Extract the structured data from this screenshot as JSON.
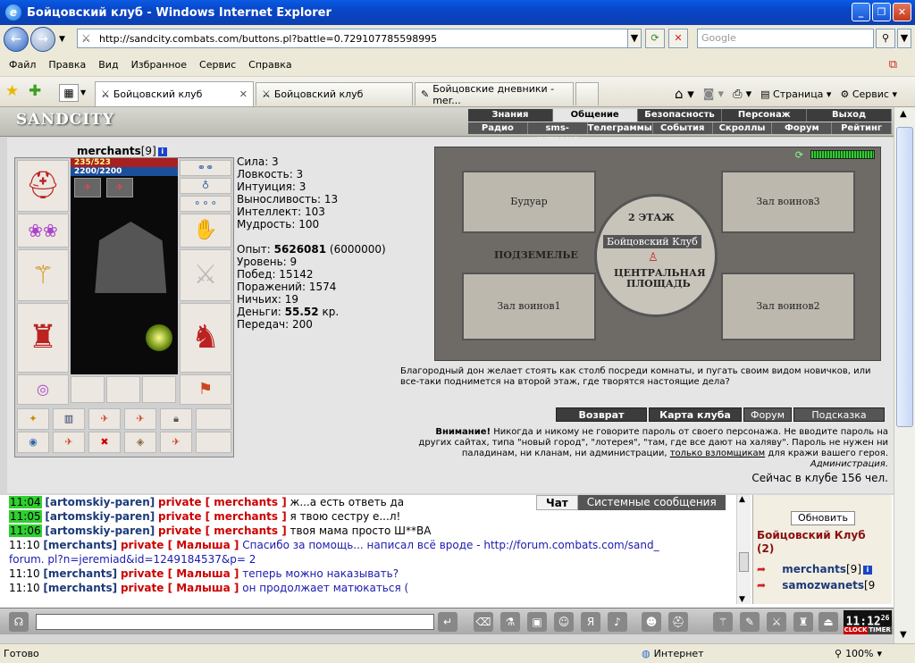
{
  "window": {
    "title": "Бойцовский клуб - Windows Internet Explorer"
  },
  "address": {
    "url": "http://sandcity.combats.com/buttons.pl?battle=0.729107785598995",
    "search_placeholder": "Google"
  },
  "menubar": [
    "Файл",
    "Правка",
    "Вид",
    "Избранное",
    "Сервис",
    "Справка"
  ],
  "tabs": [
    {
      "label": "Бойцовский клуб"
    },
    {
      "label": "Бойцовский клуб"
    },
    {
      "label": "Бойцовские дневники - mer..."
    }
  ],
  "toolbar": {
    "page": "Страница",
    "service": "Сервис"
  },
  "game": {
    "logo": "SANDCITY",
    "main_menu": [
      "Знания",
      "Общение",
      "Безопасность",
      "Персонаж",
      "Выход"
    ],
    "sub_menu": [
      "Радио",
      "sms-история",
      "Телеграммы",
      "События",
      "Скроллы",
      "Форум",
      "Рейтинг"
    ],
    "character": {
      "name": "merchants",
      "level": "[9]",
      "hp": "235/523",
      "mp": "2200/2200"
    },
    "stats": [
      "Сила: 3",
      "Ловкость: 3",
      "Интуиция: 3",
      "Выносливость: 13",
      "Интеллект: 103",
      "Мудрость: 100"
    ],
    "progress": {
      "exp_label": "Опыт:",
      "exp_value": "5626081",
      "exp_next": "(6000000)",
      "level": "Уровень: 9",
      "wins": "Побед: 15142",
      "losses": "Поражений: 1574",
      "draws": "Ничьих: 19",
      "money_label": "Деньги:",
      "money_value": "55.52",
      "money_unit": "кр.",
      "transfers": "Передач: 200"
    },
    "map": {
      "boudoir": "Будуар",
      "hall3": "Зал воинов3",
      "floor2": "2 ЭТАЖ",
      "club": "Бойцовский Клуб",
      "underground": "ПОДЗЕМЕЛЬЕ",
      "central1": "ЦЕНТРАЛЬНАЯ",
      "central2": "ПЛОЩАДЬ",
      "hall1": "Зал воинов1",
      "hall2": "Зал воинов2"
    },
    "description": "Благородный дон желает стоять как столб посреди комнаты, и пугать своим видом новичков, или все-таки поднимется на второй этаж, где творятся настоящие дела?",
    "buttons": {
      "back": "Возврат",
      "map": "Карта клуба",
      "forum": "Форум",
      "hint": "Подсказка"
    },
    "warning": {
      "label": "Внимание!",
      "text1": " Никогда и никому не говорите пароль от своего персонажа. Не вводите пароль на других сайтах, типа \"новый город\", \"лотерея\", \"там, где все дают на халяву\". Пароль не нужен ни паладинам, ни кланам, ни администрации, ",
      "link": "только взломщикам",
      "text2": " для кражи вашего героя.",
      "sign": "Администрация."
    },
    "online": "Сейчас в клубе 156 чел."
  },
  "chat": {
    "tab_chat": "Чат",
    "tab_system": "Системные сообщения",
    "lines": [
      {
        "time": "11:04",
        "hl": true,
        "nick": "[artomskiy-paren]",
        "priv": "private [ merchants ]",
        "msg": "ж...а есть ответь да",
        "mine": false
      },
      {
        "time": "11:05",
        "hl": true,
        "nick": "[artomskiy-paren]",
        "priv": "private [ merchants ]",
        "msg": "я твою сестру е...л!",
        "mine": false
      },
      {
        "time": "11:06",
        "hl": true,
        "nick": "[artomskiy-paren]",
        "priv": "private [ merchants ]",
        "msg": "твоя мама просто Ш**ВА",
        "mine": false
      },
      {
        "time": "11:10",
        "hl": false,
        "nick": "[merchants]",
        "priv": "private [ Малыша ]",
        "msg": "Спасибо за помощь... написал всё вроде - http://forum.combats.com/sand_",
        "mine": true
      },
      {
        "time": "",
        "hl": false,
        "nick": "",
        "priv": "",
        "msg": "forum. pl?n=jeremiad&id=1249184537&p= 2",
        "mine": true
      },
      {
        "time": "11:10",
        "hl": false,
        "nick": "[merchants]",
        "priv": "private [ Малыша ]",
        "msg": "теперь можно наказывать?",
        "mine": true
      },
      {
        "time": "11:10",
        "hl": false,
        "nick": "[merchants]",
        "priv": "private [ Малыша ]",
        "msg": "он продолжает матюкаться (",
        "mine": true
      }
    ],
    "refresh": "Обновить",
    "room": "Бойцовский Клуб",
    "room_count": "(2)",
    "users": [
      {
        "name": "merchants",
        "level": "[9]"
      },
      {
        "name": "samozwanets",
        "level": "[9"
      }
    ]
  },
  "clock": {
    "time": "11:12",
    "sec": "26",
    "clock_label": "CLOCK",
    "timer_label": "TIMER"
  },
  "status": {
    "ready": "Готово",
    "zone": "Интернет",
    "zoom": "100%"
  }
}
